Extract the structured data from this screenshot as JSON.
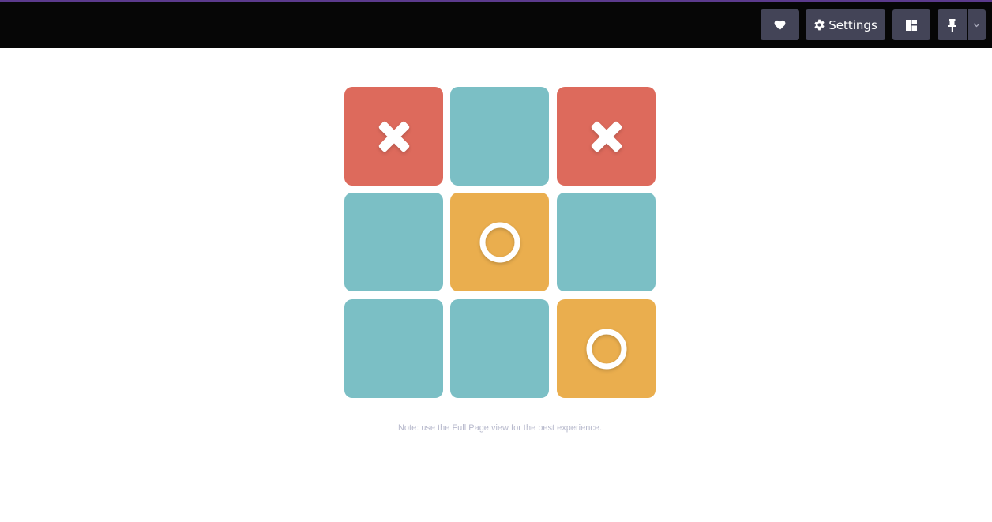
{
  "toolbar": {
    "heart_icon": "heart-icon",
    "settings_label": "Settings",
    "settings_icon": "gear-icon",
    "layout_icon": "layout-icon",
    "pin_icon": "pin-icon",
    "dropdown_icon": "chevron-down-icon"
  },
  "board": {
    "cells": [
      {
        "mark": "X",
        "color": "#dd6a5c"
      },
      {
        "mark": "",
        "color": "#7bbfc5"
      },
      {
        "mark": "X",
        "color": "#dd6a5c"
      },
      {
        "mark": "",
        "color": "#7bbfc5"
      },
      {
        "mark": "O",
        "color": "#eaae4e"
      },
      {
        "mark": "",
        "color": "#7bbfc5"
      },
      {
        "mark": "",
        "color": "#7bbfc5"
      },
      {
        "mark": "",
        "color": "#7bbfc5"
      },
      {
        "mark": "O",
        "color": "#eaae4e"
      }
    ]
  },
  "note": "Note: use the Full Page view for the best experience.",
  "colors": {
    "topbar_bg": "#060606",
    "topbar_accent": "#5b3a8c",
    "button_bg": "#434457",
    "x_cell": "#dd6a5c",
    "o_cell": "#eaae4e",
    "empty_cell": "#7bbfc5",
    "note_text": "#b7b9cc"
  }
}
